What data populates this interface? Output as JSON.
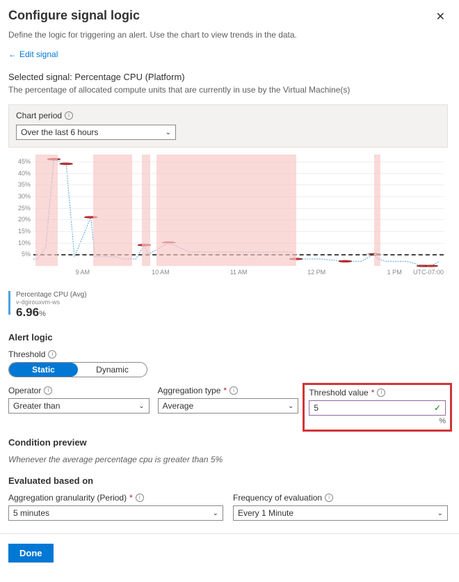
{
  "header": {
    "title": "Configure signal logic",
    "description": "Define the logic for triggering an alert. Use the chart to view trends in the data.",
    "edit_link": "Edit signal"
  },
  "signal": {
    "selected_label": "Selected signal:",
    "selected_value": "Percentage CPU (Platform)",
    "description": "The percentage of allocated compute units that are currently in use by the Virtual Machine(s)"
  },
  "chart_period": {
    "label": "Chart period",
    "value": "Over the last 6 hours"
  },
  "chart_data": {
    "type": "line",
    "title": "",
    "xlabel": "",
    "ylabel": "",
    "ylim": [
      0,
      48
    ],
    "y_ticks": [
      "5%",
      "10%",
      "15%",
      "20%",
      "25%",
      "30%",
      "35%",
      "40%",
      "45%"
    ],
    "x_ticks": [
      "9 AM",
      "10 AM",
      "11 AM",
      "12 PM",
      "1 PM"
    ],
    "timezone": "UTC-07:00",
    "threshold": 5,
    "highlight_bands_pct": [
      {
        "left": 0.5,
        "width": 5.5
      },
      {
        "left": 14.5,
        "width": 9.5
      },
      {
        "left": 26.5,
        "width": 2
      },
      {
        "left": 30,
        "width": 34
      },
      {
        "left": 83,
        "width": 1.5
      }
    ],
    "x_pct": [
      0,
      1,
      3,
      5,
      8,
      10,
      14,
      15,
      17,
      20,
      22,
      25,
      27,
      28,
      33,
      38,
      44,
      50,
      56,
      63,
      64,
      70,
      76,
      80,
      83,
      84,
      86,
      88,
      91,
      95,
      97,
      99
    ],
    "series": [
      {
        "name": "Percentage CPU (Avg)",
        "color": "#4aa3df",
        "values": [
          3,
          3,
          8,
          46,
          44,
          4,
          21,
          4,
          4,
          4,
          3,
          3,
          9,
          5,
          10,
          6,
          6,
          6,
          6,
          6,
          3,
          3,
          2,
          2,
          5,
          3,
          2,
          2,
          2,
          0,
          0,
          2
        ]
      }
    ],
    "marker_indices": [
      3,
      4,
      6,
      12,
      14,
      20,
      22,
      24,
      29,
      30
    ]
  },
  "summary": {
    "label": "Percentage CPU (Avg)",
    "subtitle": "v-dgirouxvm-ws",
    "value": "6.96",
    "unit": "%"
  },
  "alert_logic": {
    "section_title": "Alert logic",
    "threshold_label": "Threshold",
    "threshold_mode": {
      "static": "Static",
      "dynamic": "Dynamic",
      "active": "static"
    },
    "operator": {
      "label": "Operator",
      "value": "Greater than"
    },
    "aggregation_type": {
      "label": "Aggregation type",
      "value": "Average"
    },
    "threshold_value": {
      "label": "Threshold value",
      "value": "5",
      "unit": "%"
    }
  },
  "condition_preview": {
    "title": "Condition preview",
    "text": "Whenever the average percentage cpu is greater than 5%"
  },
  "evaluated": {
    "title": "Evaluated based on",
    "granularity": {
      "label": "Aggregation granularity (Period)",
      "value": "5 minutes"
    },
    "frequency": {
      "label": "Frequency of evaluation",
      "value": "Every 1 Minute"
    }
  },
  "footer": {
    "done": "Done"
  }
}
